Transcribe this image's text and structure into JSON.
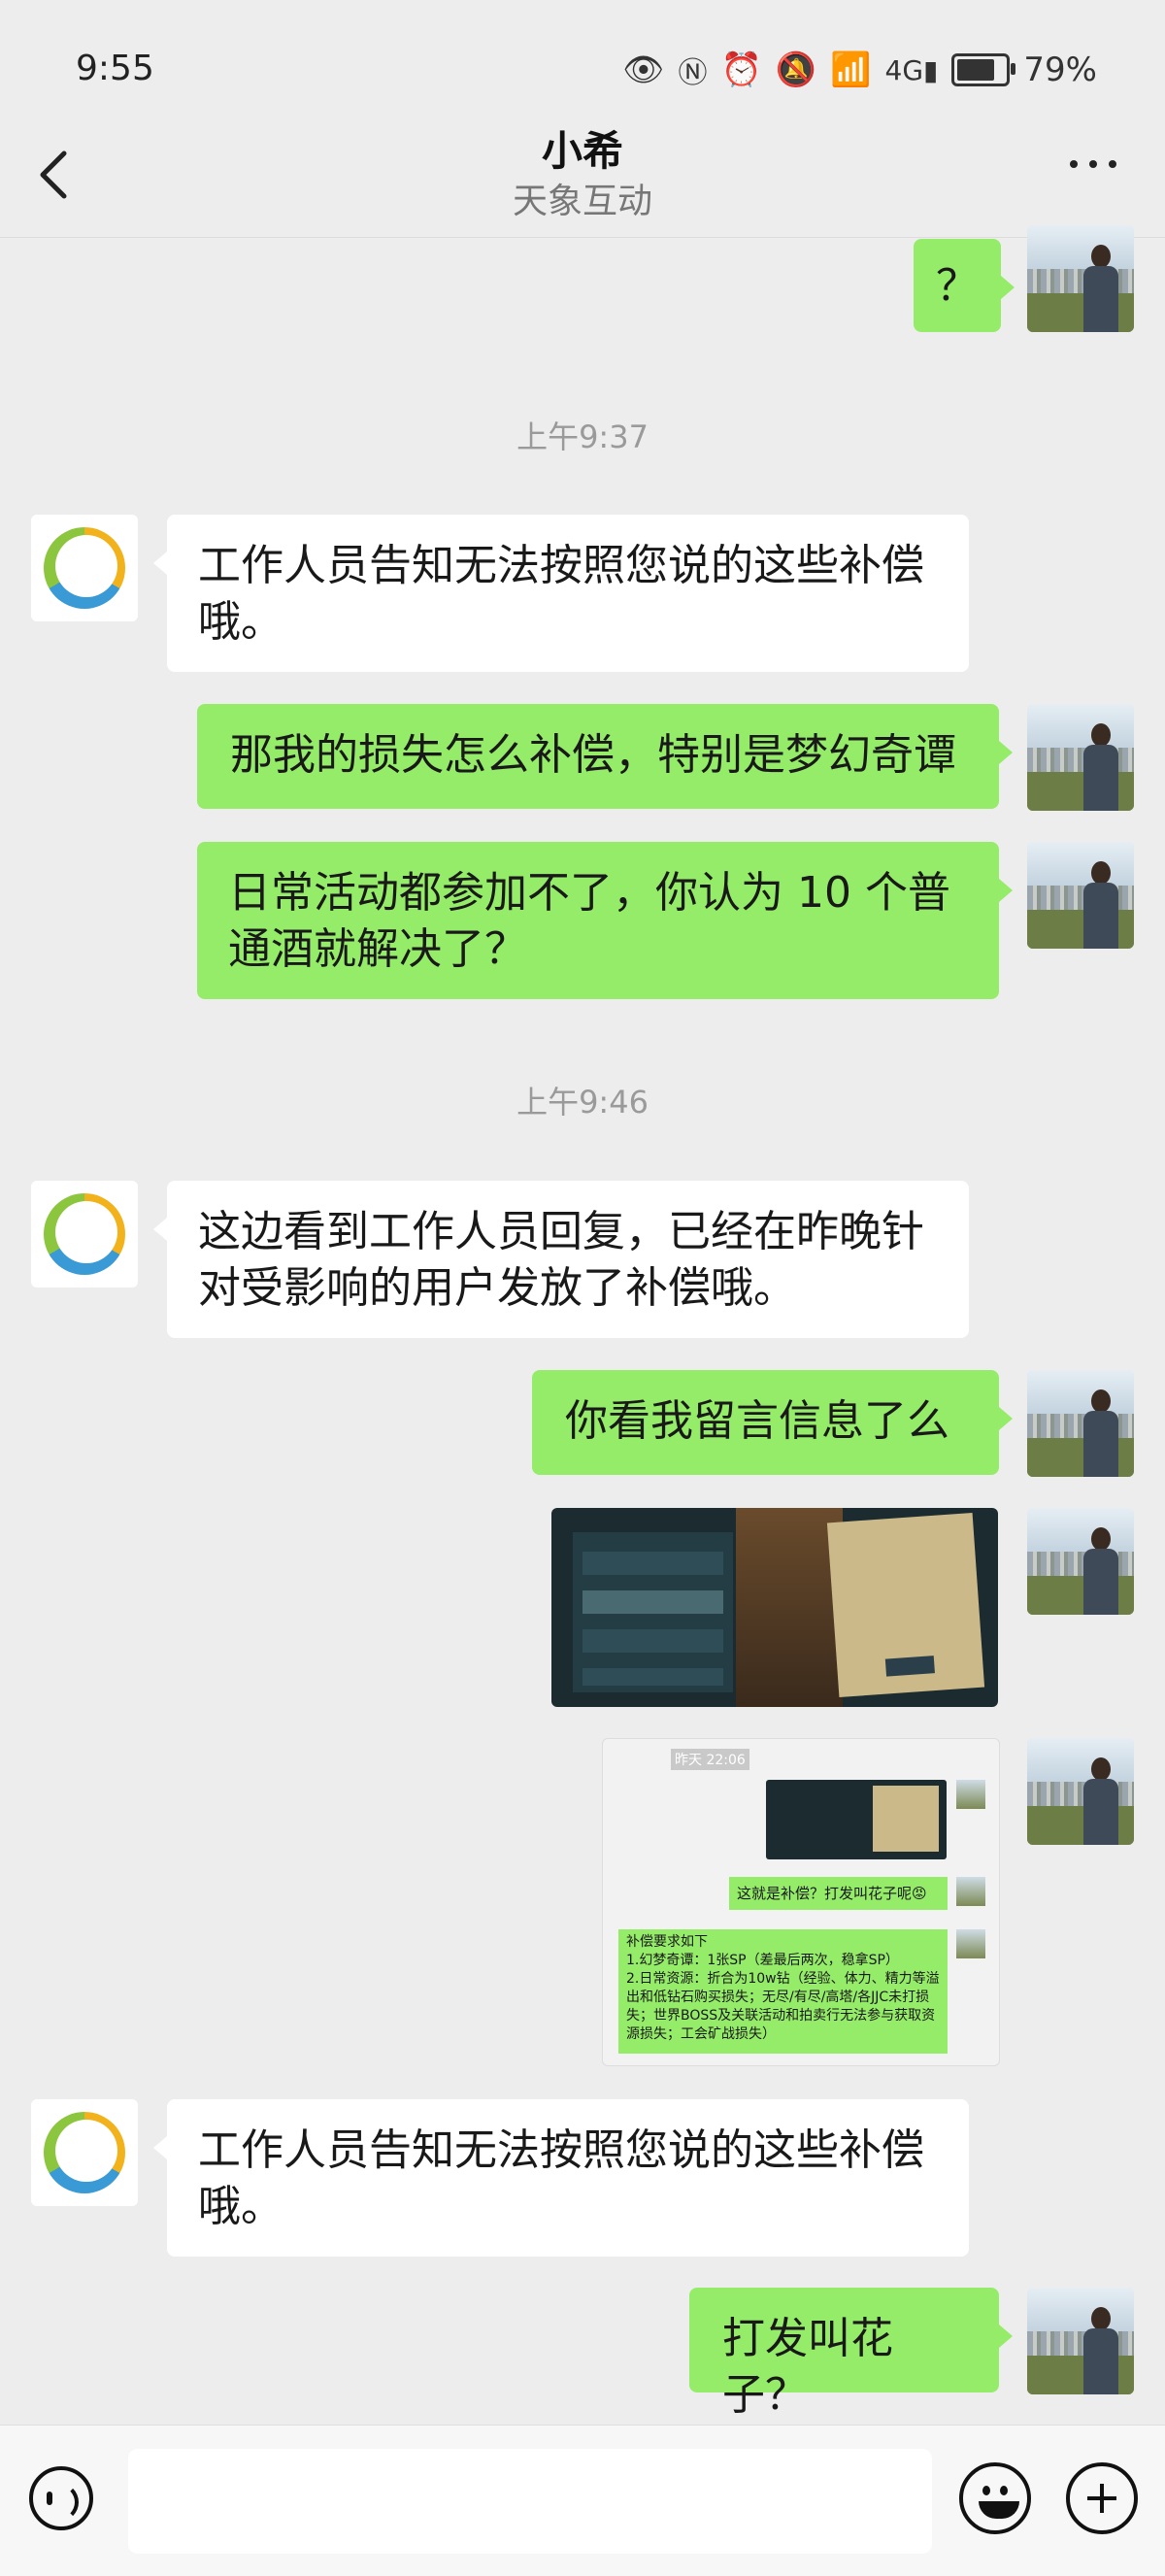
{
  "status_bar": {
    "time": "9:55",
    "battery": "79%",
    "battery_level": 0.79,
    "icons": [
      "eye-icon",
      "nfc-icon",
      "alarm-icon",
      "mute-icon",
      "wifi-icon",
      "4g-icon",
      "signal-icon",
      "battery-icon"
    ]
  },
  "header": {
    "title": "小希",
    "subtitle": "天象互动"
  },
  "messages": [
    {
      "side": "out",
      "type": "text",
      "text": "？"
    },
    {
      "type": "timestamp",
      "text": "上午9:37"
    },
    {
      "side": "in",
      "type": "text",
      "text": "工作人员告知无法按照您说的这些补偿哦。"
    },
    {
      "side": "out",
      "type": "text",
      "text": "那我的损失怎么补偿，特别是梦幻奇谭"
    },
    {
      "side": "out",
      "type": "text",
      "text": "日常活动都参加不了，你认为 10 个普通酒就解决了？"
    },
    {
      "type": "timestamp",
      "text": "上午9:46"
    },
    {
      "side": "in",
      "type": "text",
      "text": "这边看到工作人员回复，已经在昨晚针对受影响的用户发放了补偿哦。"
    },
    {
      "side": "out",
      "type": "text",
      "text": "你看我留言信息了么"
    },
    {
      "side": "out",
      "type": "image",
      "description": "game-screenshot"
    },
    {
      "side": "out",
      "type": "image",
      "description": "chat-screenshot",
      "embedded": {
        "timestamp": "昨天 22:06",
        "bubble_1": "这就是补偿？打发叫花子呢😡",
        "bubble_2": "补偿要求如下\n1.幻梦奇谭：1张SP（差最后两次，稳拿SP）\n2.日常资源：折合为10w钻（经验、体力、精力等溢出和低钻石购买损失；无尽/有尽/高塔/各JJC未打损失；世界BOSS及关联活动和拍卖行无法参与获取资源损失；工会矿战损失）"
      }
    },
    {
      "side": "in",
      "type": "text",
      "text": "工作人员告知无法按照您说的这些补偿哦。"
    },
    {
      "side": "out",
      "type": "text",
      "text": "打发叫花子？"
    }
  ],
  "input": {
    "value": ""
  },
  "colors": {
    "background": "#ededed",
    "outgoing_bubble": "#95ec69",
    "incoming_bubble": "#ffffff"
  }
}
